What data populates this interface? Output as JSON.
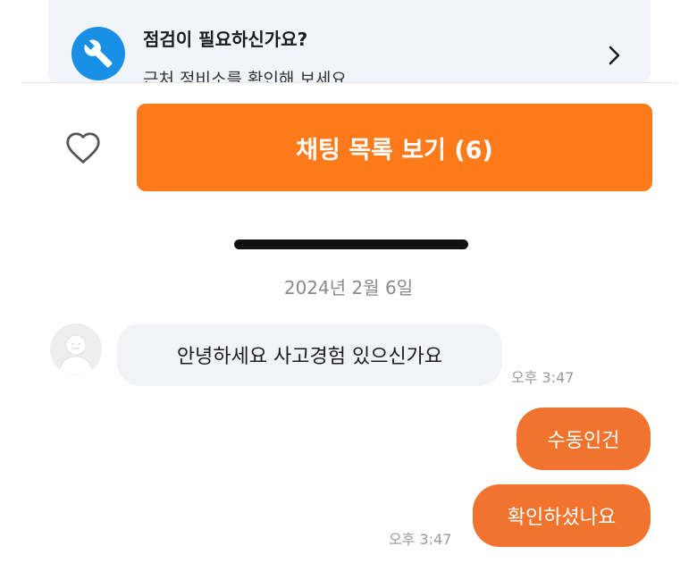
{
  "banner": {
    "title": "점검이 필요하신가요?",
    "subtitle": "근처 정비소를 확인해 보세요.",
    "icon": "wrench-icon",
    "chevron_icon": "chevron-right-icon"
  },
  "actions": {
    "heart_icon": "heart-outline-icon",
    "chat_list_label": "채팅 목록 보기 (6)"
  },
  "chat": {
    "date": "2024년 2월 6일",
    "messages": [
      {
        "direction": "incoming",
        "text": "안녕하세요  사고경험 있으신가요",
        "time": "오후 3:47"
      },
      {
        "direction": "outgoing",
        "text": "수동인건"
      },
      {
        "direction": "outgoing",
        "text": "확인하셨나요",
        "time": "오후 3:47"
      }
    ]
  },
  "colors": {
    "accent_orange": "#ff7a1a",
    "outgoing_bubble": "#f2732d",
    "incoming_bubble": "#f1f3f6",
    "wrench_blue": "#1a8fe6",
    "banner_bg": "#f1f5fa"
  }
}
